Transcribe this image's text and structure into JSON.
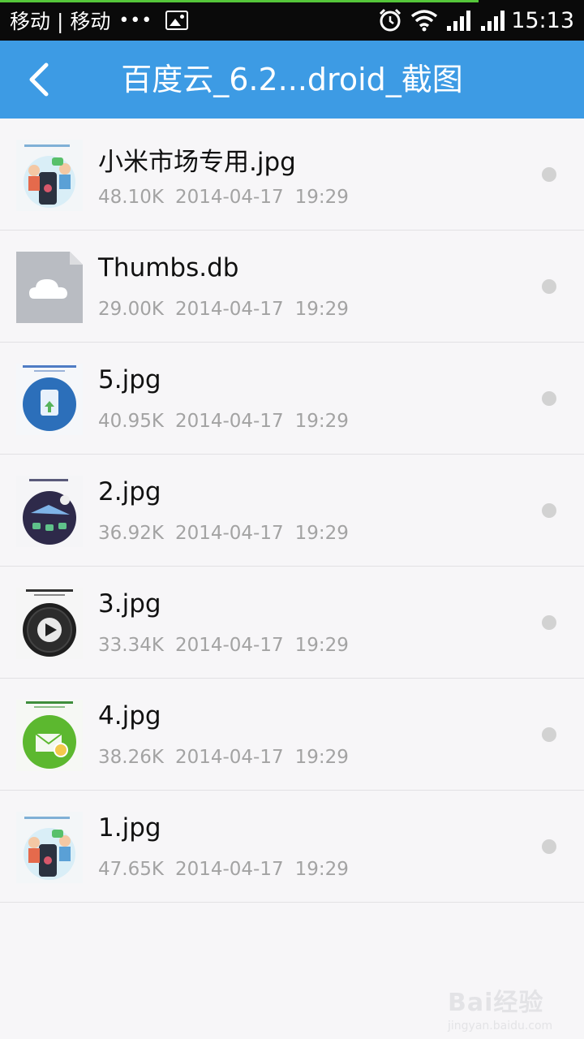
{
  "status_bar": {
    "carrier": "移动 | 移动",
    "dots": "•••",
    "time": "15:13",
    "icons": [
      "image-notification-icon",
      "alarm-icon",
      "wifi-icon",
      "signal-icon",
      "signal-icon"
    ]
  },
  "action_bar": {
    "back_icon": "chevron-left-icon",
    "title": "百度云_6.2...droid_截图"
  },
  "files": [
    {
      "name": "小米市场专用.jpg",
      "size": "48.10K",
      "date": "2014-04-17",
      "time": "19:29",
      "thumb": "image-thumbnail-people"
    },
    {
      "name": "Thumbs.db",
      "size": "29.00K",
      "date": "2014-04-17",
      "time": "19:29",
      "thumb": "cloud-file-icon"
    },
    {
      "name": "5.jpg",
      "size": "40.95K",
      "date": "2014-04-17",
      "time": "19:29",
      "thumb": "image-thumbnail-blue"
    },
    {
      "name": "2.jpg",
      "size": "36.92K",
      "date": "2014-04-17",
      "time": "19:29",
      "thumb": "image-thumbnail-night"
    },
    {
      "name": "3.jpg",
      "size": "33.34K",
      "date": "2014-04-17",
      "time": "19:29",
      "thumb": "image-thumbnail-play"
    },
    {
      "name": "4.jpg",
      "size": "38.26K",
      "date": "2014-04-17",
      "time": "19:29",
      "thumb": "image-thumbnail-green"
    },
    {
      "name": "1.jpg",
      "size": "47.65K",
      "date": "2014-04-17",
      "time": "19:29",
      "thumb": "image-thumbnail-people"
    }
  ],
  "watermark": {
    "main": "Bai经验",
    "sub": "jingyan.baidu.com"
  },
  "colors": {
    "action_bar": "#3d9be4",
    "status_bar": "#0a0a0a",
    "meta_text": "#a3a3a3"
  }
}
